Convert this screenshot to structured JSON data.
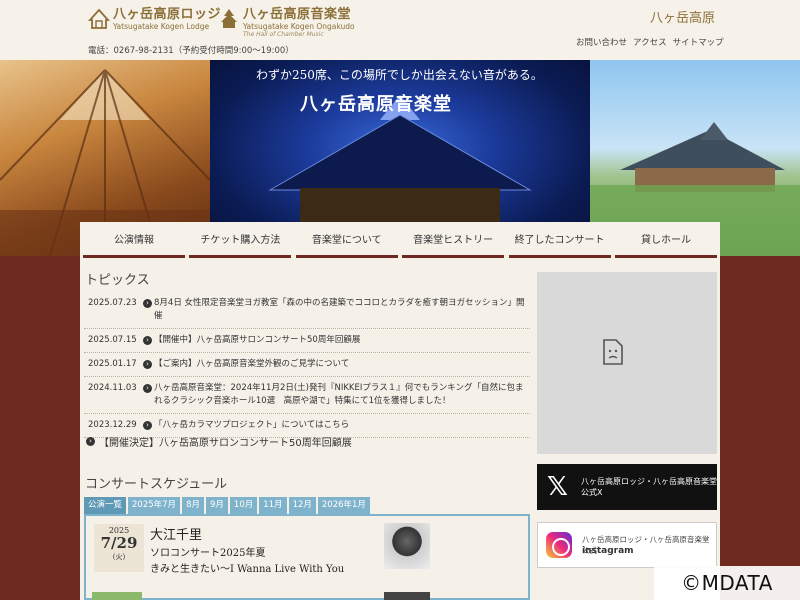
{
  "header": {
    "lodge_logo_jp": "八ヶ岳高原ロッジ",
    "lodge_logo_en": "Yatsugatake Kogen Lodge",
    "hall_logo_jp": "八ヶ岳高原音楽堂",
    "hall_logo_en": "Yatsugatake Kogen Ongakudo",
    "hall_logo_en_sub": "The Hall of Chamber Music",
    "phone": "電話：0267-98-2131（予約受付時間9:00～19:00）",
    "brand_right": "八ヶ岳高原",
    "util_links": [
      "お問い合わせ",
      "アクセス",
      "サイトマップ"
    ]
  },
  "hero": {
    "tagline": "わずか250席、この場所でしか出会えない音がある。",
    "title": "八ヶ岳高原音楽堂"
  },
  "nav": [
    "公演情報",
    "チケット購入方法",
    "音楽堂について",
    "音楽堂ヒストリー",
    "終了したコンサート",
    "貸しホール"
  ],
  "topics": {
    "title": "トピックス",
    "items": [
      {
        "date": "2025.07.23",
        "text": "8月4日 女性限定音楽堂ヨガ教室「森の中の名建築でココロとカラダを癒す朝ヨガセッション」開催"
      },
      {
        "date": "2025.07.15",
        "text": "【開催中】八ヶ岳高原サロンコンサート50周年回顧展"
      },
      {
        "date": "2025.01.17",
        "text": "【ご案内】八ヶ岳高原音楽堂外観のご見学について"
      },
      {
        "date": "2024.11.03",
        "text": "八ヶ岳高原音楽堂：2024年11月2日(土)発刊『NIKKEIプラス１』何でもランキング「自然に包まれるクラシック音楽ホール10選　高原や湖で」特集にて1位を獲得しました！"
      },
      {
        "date": "2023.12.29",
        "text": "「八ヶ岳カラマツプロジェクト」についてはこちら"
      }
    ],
    "featured": "【開催決定】八ヶ岳高原サロンコンサート50周年回顧展"
  },
  "schedule": {
    "title": "コンサートスケジュール",
    "tabs": [
      "公演一覧",
      "2025年7月",
      "8月",
      "9月",
      "10月",
      "11月",
      "12月",
      "2026年1月"
    ],
    "concert": {
      "year": "2025",
      "month_day": "7/29",
      "weekday": "(火)",
      "performer": "大江千里",
      "title": "ソロコンサート2025年夏",
      "subtitle": "きみと生きたい〜I Wanna Live With You"
    }
  },
  "sidebar": {
    "x_label": "八ヶ岳高原ロッジ・八ヶ岳高原音楽堂 公式X",
    "ig_label": "八ヶ岳高原ロッジ・八ヶ岳高原音楽堂公式",
    "ig_brand": "instagram"
  },
  "watermark": "©MDATA",
  "colors": {
    "header_bg": "#f6f2ea",
    "background": "#6e2a1e",
    "accent_brown": "#8c6f37",
    "tab_blue": "#7fb3cc"
  }
}
